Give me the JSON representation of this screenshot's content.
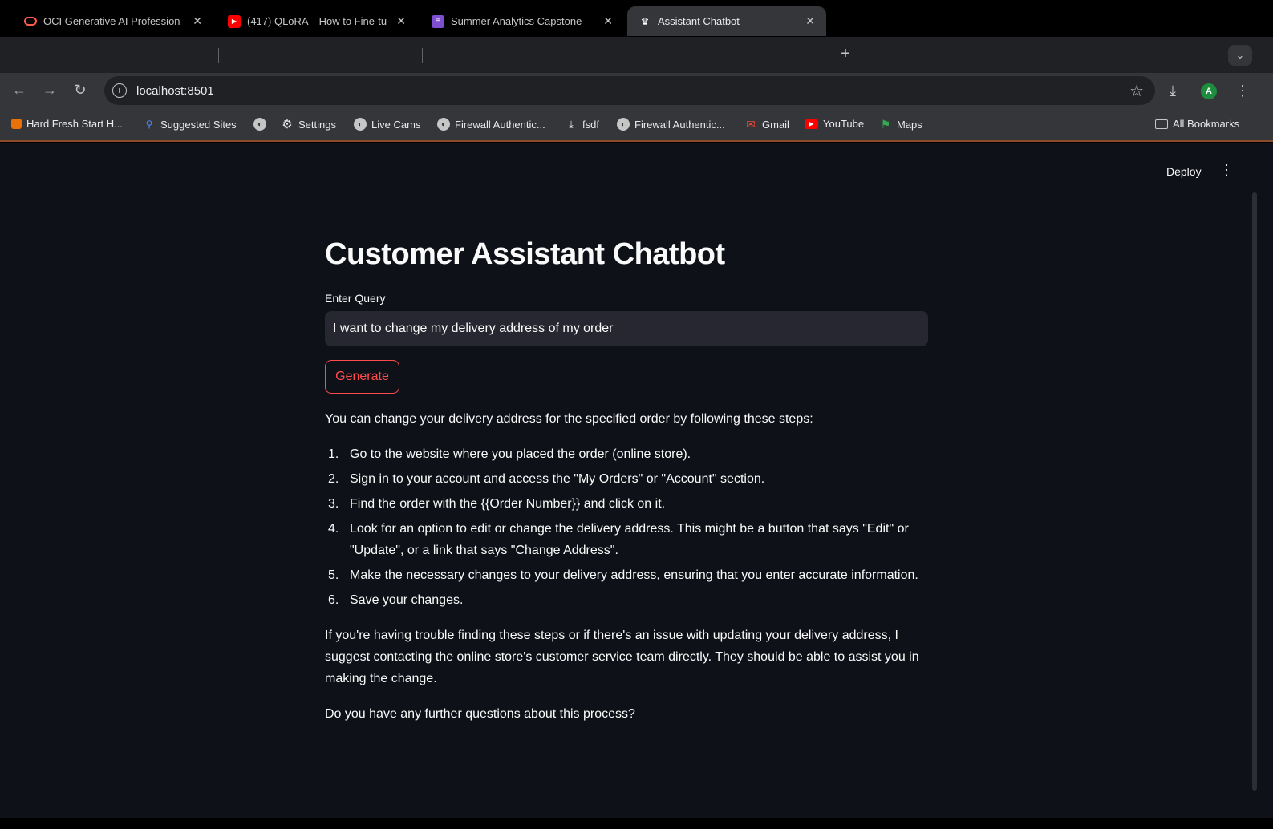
{
  "browser": {
    "tabs": [
      {
        "title": "OCI Generative AI Profession",
        "favicon": "oracle-icon",
        "color": "#ff5b4b",
        "active": false
      },
      {
        "title": "(417) QLoRA—How to Fine-tu",
        "favicon": "youtube-icon",
        "color": "#ff0000",
        "active": false
      },
      {
        "title": "Summer Analytics Capstone",
        "favicon": "forms-icon",
        "color": "#7b4fd0",
        "active": false
      },
      {
        "title": "Assistant Chatbot",
        "favicon": "streamlit-crown-icon",
        "color": "#ffffff",
        "active": true
      }
    ],
    "url": "localhost:8501",
    "profile_initial": "A",
    "bookmarks": [
      {
        "label": "Hard Fresh Start H...",
        "icon": "bookmark-orange-icon"
      },
      {
        "label": "Suggested Sites",
        "icon": "search-icon"
      },
      {
        "label": "",
        "icon": "globe-icon"
      },
      {
        "label": "Settings",
        "icon": "gear-icon"
      },
      {
        "label": "Live Cams",
        "icon": "globe-icon"
      },
      {
        "label": "Firewall Authentic...",
        "icon": "globe-icon"
      },
      {
        "label": "fsdf",
        "icon": "download-icon"
      },
      {
        "label": "Firewall Authentic...",
        "icon": "globe-icon"
      },
      {
        "label": "Gmail",
        "icon": "gmail-icon"
      },
      {
        "label": "YouTube",
        "icon": "youtube-icon"
      },
      {
        "label": "Maps",
        "icon": "maps-icon"
      }
    ],
    "all_bookmarks": "All Bookmarks"
  },
  "app": {
    "deploy_label": "Deploy",
    "title": "Customer Assistant Chatbot",
    "query_label": "Enter Query",
    "query_value": "I want to change my delivery address of my order",
    "generate_label": "Generate",
    "answer": {
      "intro": "You can change your delivery address for the specified order by following these steps:",
      "steps": [
        "Go to the website where you placed the order (online store).",
        "Sign in to your account and access the \"My Orders\" or \"Account\" section.",
        "Find the order with the {{Order Number}} and click on it.",
        "Look for an option to edit or change the delivery address. This might be a button that says \"Edit\" or \"Update\", or a link that says \"Change Address\".",
        "Make the necessary changes to your delivery address, ensuring that you enter accurate information.",
        "Save your changes."
      ],
      "step_numbers": [
        "1.",
        "2.",
        "3.",
        "4.",
        "5.",
        "6."
      ],
      "followup": "If you're having trouble finding these steps or if there's an issue with updating your delivery address, I suggest contacting the online store's customer service team directly. They should be able to assist you in making the change.",
      "closing": "Do you have any further questions about this process?"
    },
    "accent_color": "#ff4b4b",
    "background_color": "#0e1117"
  }
}
